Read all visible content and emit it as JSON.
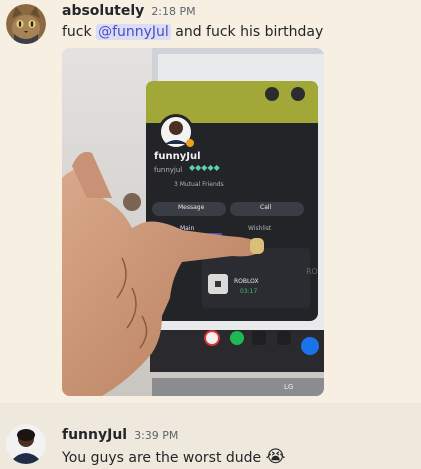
{
  "messages": [
    {
      "username": "absolutely",
      "timestamp": "2:18 PM",
      "text_before": "fuck ",
      "mention": "@funnyJul",
      "text_after": " and fuck his birthday",
      "avatar_icon": "cat-avatar-icon"
    },
    {
      "username": "funnyJul",
      "timestamp": "3:39 PM",
      "text": "You guys are the worst dude ",
      "emoji": "😭",
      "avatar_icon": "person-avatar-icon"
    }
  ],
  "photo": {
    "profile_name": "funnyJul",
    "profile_handle": "funnyjul",
    "mutual_friends": "3 Mutual Friends",
    "message_button": "Message",
    "call_button": "Call",
    "tab_main": "Main",
    "tab_wishlist": "Wishlist",
    "activity_title": "ROBLOX",
    "activity_time": "03:17",
    "side_text": "RO",
    "tv_logo": "LG",
    "colors": {
      "banner": "#a2a837",
      "card": "#232428",
      "accent": "#5865f2"
    }
  }
}
